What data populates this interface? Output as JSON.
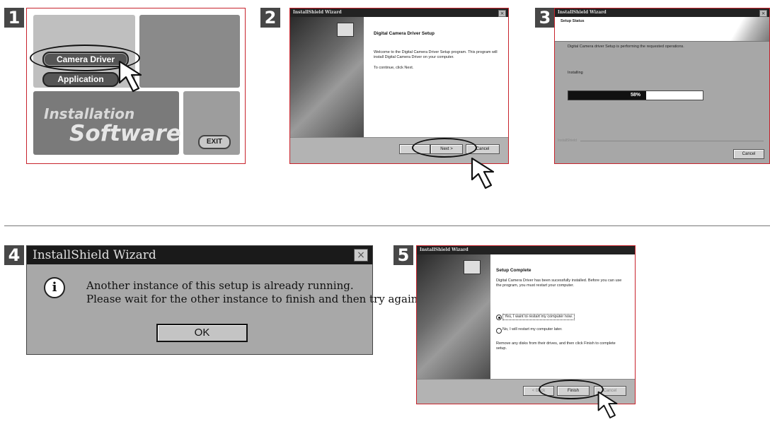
{
  "steps": {
    "s1": {
      "num": "1"
    },
    "s2": {
      "num": "2"
    },
    "s3": {
      "num": "3"
    },
    "s4": {
      "num": "4"
    },
    "s5": {
      "num": "5"
    }
  },
  "menu": {
    "camera_driver": "Camera Driver",
    "application": "Application",
    "title_line1": "Installation",
    "title_line2": "Software",
    "exit": "EXIT"
  },
  "welcome": {
    "window_title": "InstallShield Wizard",
    "heading": "Digital Camera Driver Setup",
    "body1": "Welcome to the Digital Camera Driver Setup program. This program will install Digital Camera Driver on your computer.",
    "body2": "To continue, click Next.",
    "next": "Next >",
    "cancel": "Cancel"
  },
  "status": {
    "window_title": "InstallShield Wizard",
    "header": "Setup Status",
    "message": "Digital Camera driver Setup is performing the requested operations.",
    "installing": "Installing",
    "progress_label": "58%",
    "progress": 0.58,
    "brand": "InstallShield",
    "cancel": "Cancel"
  },
  "error": {
    "window_title": "InstallShield Wizard",
    "line1": "Another instance of this setup is already running.",
    "line2": "Please wait for the other instance to finish and then try again.",
    "ok": "OK"
  },
  "complete": {
    "window_title": "InstallShield Wizard",
    "heading": "Setup Complete",
    "body": "Digital Camera Driver has been sucessfully installed. Before you can use the program, you must restart your computer.",
    "opt_yes": "Yes, I want to restart my computer now.",
    "opt_no": "No, I will restart my computer later.",
    "remove": "Remove any disks from their drives, and then click Finish to complete setup.",
    "back": "< Back",
    "finish": "Finish",
    "cancel": "Cancel"
  }
}
